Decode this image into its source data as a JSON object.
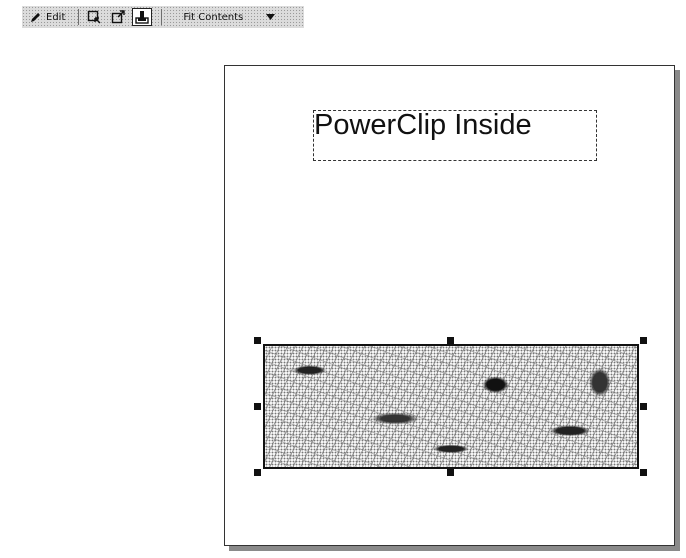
{
  "toolbar": {
    "edit_label": "Edit",
    "buttons": [
      {
        "name": "select-contents-button",
        "icon": "select-contents-icon"
      },
      {
        "name": "extract-contents-button",
        "icon": "extract-contents-icon"
      },
      {
        "name": "lock-contents-button",
        "icon": "lock-contents-icon",
        "pressed": true
      }
    ],
    "fit_dropdown": {
      "selected": "Fit Contents",
      "icon": "chevron-down-icon"
    }
  },
  "canvas": {
    "text_object": "PowerClip Inside",
    "image_object": {
      "content": "textured-photo",
      "selected": true
    }
  },
  "colors": {
    "toolbar_bg": "#dcdcdc",
    "page_border": "#333333",
    "selection_handle": "#111111"
  }
}
